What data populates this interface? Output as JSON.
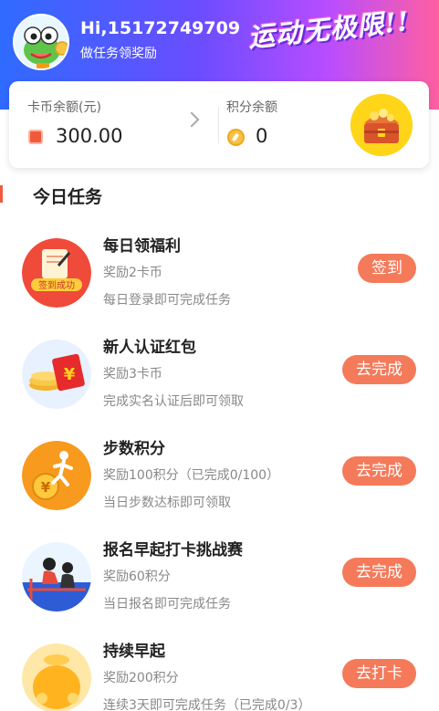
{
  "header": {
    "greeting": "Hi,15172749709",
    "subtitle": "做任务领奖励",
    "slogan": "运动无极限!!",
    "avatar_icon": "frog-avatar-icon"
  },
  "balance": {
    "card_label": "卡币余额(元)",
    "card_value": "300.00",
    "card_icon": "card-coin-icon",
    "points_label": "积分余额",
    "points_value": "0",
    "points_icon": "points-coin-icon",
    "chest_icon": "treasure-chest-icon"
  },
  "section": {
    "title": "今日任务"
  },
  "tasks": [
    {
      "title": "每日领福利",
      "reward": "奖励2卡币",
      "desc": "每日登录即可完成任务",
      "button": "签到",
      "icon": "signin-success-icon",
      "icon_text": "签到成功"
    },
    {
      "title": "新人认证红包",
      "reward": "奖励3卡币",
      "desc": "完成实名认证后即可领取",
      "button": "去完成",
      "icon": "red-envelope-icon",
      "icon_text": "¥"
    },
    {
      "title": "步数积分",
      "reward": "奖励100积分（已完成0/100）",
      "desc": "当日步数达标即可领取",
      "button": "去完成",
      "icon": "runner-icon",
      "icon_text": "¥"
    },
    {
      "title": "报名早起打卡挑战赛",
      "reward": "奖励60积分",
      "desc": "当日报名即可完成任务",
      "button": "去完成",
      "icon": "workout-icon"
    },
    {
      "title": "持续早起",
      "reward": "奖励200积分",
      "desc": "连续3天即可完成任务（已完成0/3）",
      "button": "去打卡",
      "icon": "gold-bag-icon"
    }
  ],
  "colors": {
    "accent": "#f47a5a",
    "header_start": "#2f6bff",
    "header_end": "#ff5fa0"
  }
}
